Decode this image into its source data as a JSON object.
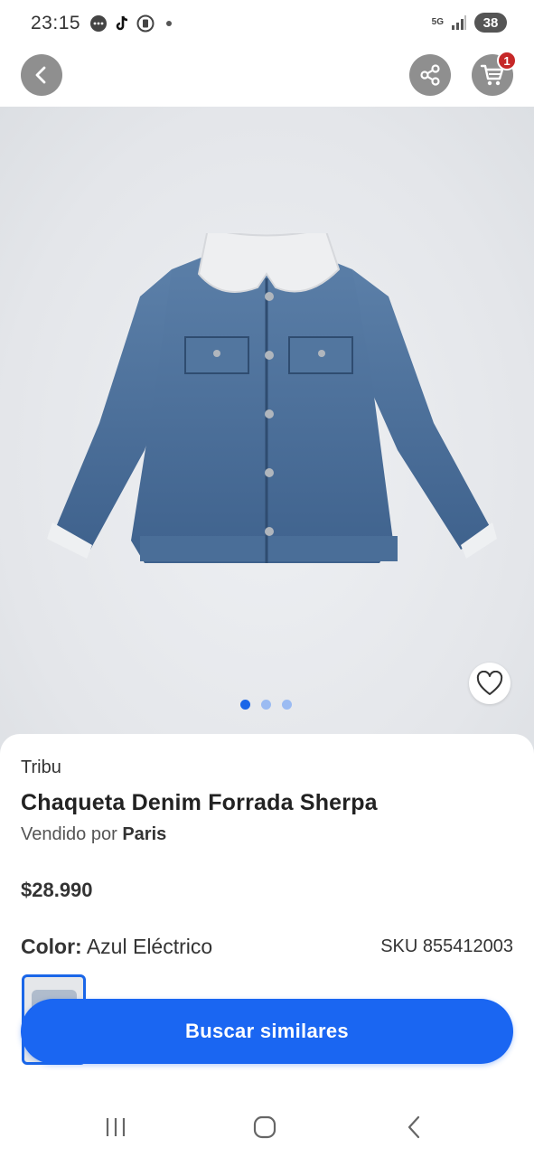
{
  "status_bar": {
    "time": "23:15",
    "network": "5G",
    "battery": "38",
    "icons": [
      "message-icon",
      "tiktok-icon",
      "app-icon",
      "signal-icon"
    ]
  },
  "nav": {
    "cart_count": "1",
    "icons": [
      "back-arrow-icon",
      "share-icon",
      "cart-icon"
    ]
  },
  "gallery": {
    "image_count": 3,
    "active_index": 0
  },
  "product": {
    "brand": "Tribu",
    "title": "Chaqueta Denim Forrada Sherpa",
    "seller_prefix": "Vendido por",
    "seller_name": "Paris",
    "price": "$28.990",
    "color_label": "Color:",
    "color_value": "Azul Eléctrico",
    "sku": "SKU 855412003"
  },
  "cta": {
    "label": "Buscar similares"
  },
  "colors": {
    "accent": "#1a66f2",
    "badge": "#c62828",
    "nav_button": "#8f8f8f"
  }
}
